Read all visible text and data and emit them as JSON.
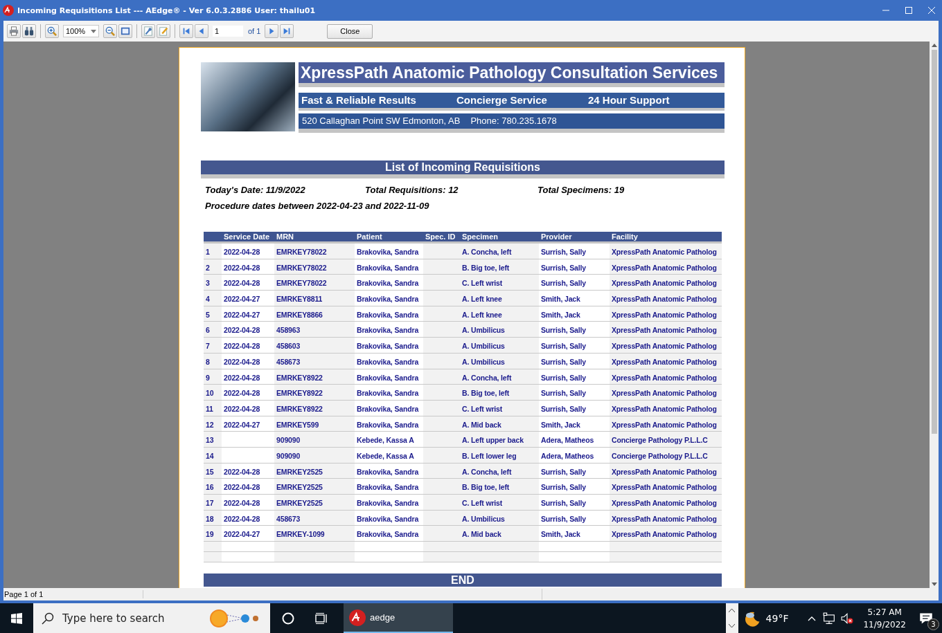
{
  "window": {
    "title": "Incoming Requisitions List --- AEdge® -  Ver 6.0.3.2886  User: thailu01"
  },
  "toolbar": {
    "zoom": "100%",
    "page": "1",
    "page_count": "of 1",
    "close": "Close"
  },
  "report": {
    "company": "XpressPath Anatomic Pathology Consultation Services",
    "taglines": [
      "Fast & Reliable Results",
      "Concierge Service",
      "24 Hour Support"
    ],
    "address": "520 Callaghan Point SW Edmonton, AB",
    "phone": "Phone: 780.235.1678",
    "title": "List of Incoming Requisitions",
    "summary": [
      "Today's Date: 11/9/2022",
      "Total Requisitions: 12",
      "Total Specimens: 19"
    ],
    "procedure_dates": "Procedure dates between 2022-04-23 and 2022-11-09",
    "table": {
      "columns": [
        "",
        "Service Date",
        "MRN",
        "Patient",
        "Spec. ID",
        "Specimen",
        "Provider",
        "Facility"
      ],
      "rows": [
        [
          "1",
          "2022-04-28",
          "EMRKEY78022",
          "Brakovika, Sandra",
          "",
          "A. Concha, left",
          "Surrish, Sally",
          "XpressPath Anatomic Patholog"
        ],
        [
          "2",
          "2022-04-28",
          "EMRKEY78022",
          "Brakovika, Sandra",
          "",
          "B. Big toe, left",
          "Surrish, Sally",
          "XpressPath Anatomic Patholog"
        ],
        [
          "3",
          "2022-04-28",
          "EMRKEY78022",
          "Brakovika, Sandra",
          "",
          "C. Left wrist",
          "Surrish, Sally",
          "XpressPath Anatomic Patholog"
        ],
        [
          "4",
          "2022-04-27",
          "EMRKEY8811",
          "Brakovika, Sandra",
          "",
          "A. Left knee",
          "Smith, Jack",
          "XpressPath Anatomic Patholog"
        ],
        [
          "5",
          "2022-04-27",
          "EMRKEY8866",
          "Brakovika, Sandra",
          "",
          "A. Left knee",
          "Smith, Jack",
          "XpressPath Anatomic Patholog"
        ],
        [
          "6",
          "2022-04-28",
          "458963",
          "Brakovika, Sandra",
          "",
          "A. Umbilicus",
          "Surrish, Sally",
          "XpressPath Anatomic Patholog"
        ],
        [
          "7",
          "2022-04-28",
          "458603",
          "Brakovika, Sandra",
          "",
          "A. Umbilicus",
          "Surrish, Sally",
          "XpressPath Anatomic Patholog"
        ],
        [
          "8",
          "2022-04-28",
          "458673",
          "Brakovika, Sandra",
          "",
          "A. Umbilicus",
          "Surrish, Sally",
          "XpressPath Anatomic Patholog"
        ],
        [
          "9",
          "2022-04-28",
          "EMRKEY8922",
          "Brakovika, Sandra",
          "",
          "A. Concha, left",
          "Surrish, Sally",
          "XpressPath Anatomic Patholog"
        ],
        [
          "10",
          "2022-04-28",
          "EMRKEY8922",
          "Brakovika, Sandra",
          "",
          "B. Big toe, left",
          "Surrish, Sally",
          "XpressPath Anatomic Patholog"
        ],
        [
          "11",
          "2022-04-28",
          "EMRKEY8922",
          "Brakovika, Sandra",
          "",
          "C. Left wrist",
          "Surrish, Sally",
          "XpressPath Anatomic Patholog"
        ],
        [
          "12",
          "2022-04-27",
          "EMRKEY599",
          "Brakovika, Sandra",
          "",
          "A. Mid back",
          "Smith, Jack",
          "XpressPath Anatomic Patholog"
        ],
        [
          "13",
          "",
          "909090",
          "Kebede, Kassa A",
          "",
          "A. Left upper back",
          "Adera, Matheos",
          "Concierge Pathology P.L.L.C"
        ],
        [
          "14",
          "",
          "909090",
          "Kebede, Kassa A",
          "",
          "B. Left lower leg",
          "Adera, Matheos",
          "Concierge Pathology P.L.L.C"
        ],
        [
          "15",
          "2022-04-28",
          "EMRKEY2525",
          "Brakovika, Sandra",
          "",
          "A. Concha, left",
          "Surrish, Sally",
          "XpressPath Anatomic Patholog"
        ],
        [
          "16",
          "2022-04-28",
          "EMRKEY2525",
          "Brakovika, Sandra",
          "",
          "B. Big toe, left",
          "Surrish, Sally",
          "XpressPath Anatomic Patholog"
        ],
        [
          "17",
          "2022-04-28",
          "EMRKEY2525",
          "Brakovika, Sandra",
          "",
          "C. Left wrist",
          "Surrish, Sally",
          "XpressPath Anatomic Patholog"
        ],
        [
          "18",
          "2022-04-28",
          "458673",
          "Brakovika, Sandra",
          "",
          "A. Umbilicus",
          "Surrish, Sally",
          "XpressPath Anatomic Patholog"
        ],
        [
          "19",
          "2022-04-27",
          "EMRKEY-1099",
          "Brakovika, Sandra",
          "",
          "A. Mid back",
          "Smith, Jack",
          "XpressPath Anatomic Patholog"
        ]
      ]
    },
    "end": "END"
  },
  "status_bar": {
    "page": "Page 1 of 1"
  },
  "taskbar": {
    "search_placeholder": "Type here to search",
    "app": "aedge",
    "temperature": "49°F",
    "time": "5:27 AM",
    "date": "11/9/2022",
    "notifications": "3"
  }
}
